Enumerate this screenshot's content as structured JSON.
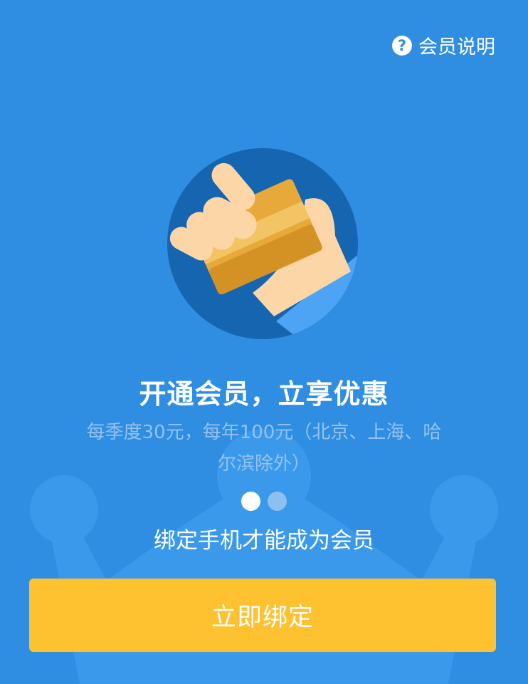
{
  "header": {
    "help_label": "会员说明",
    "help_icon": "question-circle-icon"
  },
  "hero": {
    "icon": "hand-holding-card-icon"
  },
  "main": {
    "title": "开通会员，立享优惠",
    "subtitle": "每季度30元，每年100元（北京、上海、哈尔滨除外）",
    "pager": {
      "count": 2,
      "active_index": 0
    },
    "note": "绑定手机才能成为会员"
  },
  "actions": {
    "bind_label": "立即绑定"
  },
  "colors": {
    "background": "#2f8ee2",
    "button": "#fec12f",
    "text": "#ffffff"
  }
}
